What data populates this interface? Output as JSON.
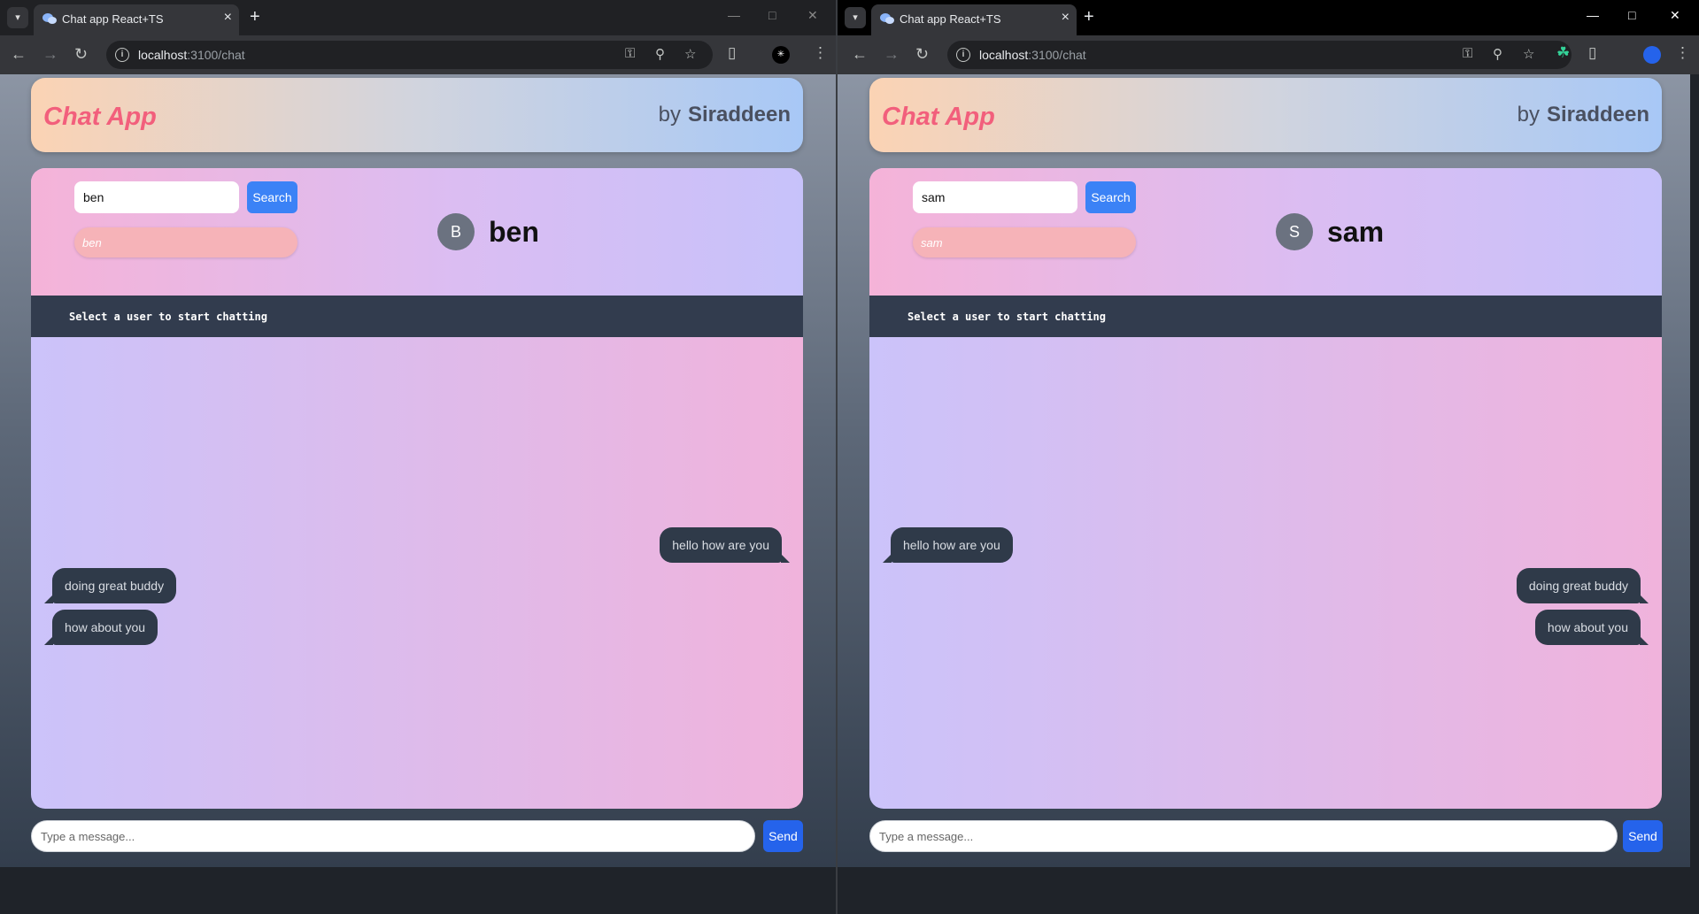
{
  "browser": {
    "tab_title": "Chat app React+TS",
    "url_host": "localhost",
    "url_path": ":3100/chat"
  },
  "app": {
    "title": "Chat App",
    "by": "by",
    "author": "Siraddeen",
    "status": "Select a user to start chatting",
    "search_button": "Search",
    "send_button": "Send",
    "message_placeholder": "Type a message..."
  },
  "left": {
    "search_value": "ben",
    "result": "ben",
    "avatar_letter": "B",
    "chat_name": "ben",
    "messages": [
      {
        "text": "hello how are you",
        "side": "right"
      },
      {
        "text": "doing great buddy",
        "side": "left"
      },
      {
        "text": "how about you",
        "side": "left"
      }
    ]
  },
  "right": {
    "search_value": "sam",
    "result": "sam",
    "avatar_letter": "S",
    "chat_name": "sam",
    "messages": [
      {
        "text": "hello how are you",
        "side": "left"
      },
      {
        "text": "doing great buddy",
        "side": "right"
      },
      {
        "text": "how about you",
        "side": "right"
      }
    ]
  },
  "colors": {
    "accent": "#3b82f6",
    "title": "#f25f7c",
    "bubble": "#2f3a49",
    "status_bar": "#323c4e"
  }
}
